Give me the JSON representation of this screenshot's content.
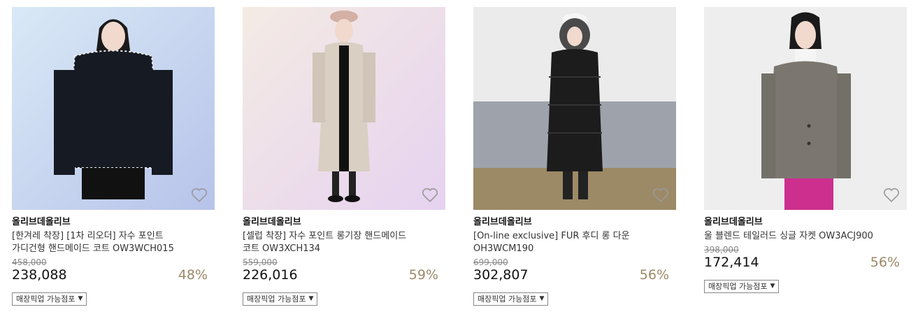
{
  "products": [
    {
      "brand": "올리브데올리브",
      "name": "[한겨레 착장] [1차 리오더] 자수 포인트 가디건형 핸드메이드 코트 OW3WCH015",
      "original_price": "458,000",
      "sale_price": "238,088",
      "discount": "48%",
      "pickup_label": "매장픽업 가능점포",
      "photo_bg": "#c6d4ec",
      "garment_color": "#161a22"
    },
    {
      "brand": "올리브데올리브",
      "name": "[셀럽 착장] 자수 포인트 롱기장 핸드메이드 코트 OW3XCH134",
      "original_price": "559,000",
      "sale_price": "226,016",
      "discount": "59%",
      "pickup_label": "매장픽업 가능점포",
      "photo_bg": "#efe0e8",
      "garment_color": "#d9cfc3"
    },
    {
      "brand": "올리브데올리브",
      "name": "[On-line exclusive] FUR 후디 롱 다운 OH3WCM190",
      "original_price": "699,000",
      "sale_price": "302,807",
      "discount": "56%",
      "pickup_label": "매장픽업 가능점포",
      "photo_bg": "#e6e6e6",
      "garment_color": "#1c1c1c"
    },
    {
      "brand": "올리브데올리브",
      "name": "울 블렌드 테일러드 싱글 자켓 OW3ACJ900",
      "original_price": "398,000",
      "sale_price": "172,414",
      "discount": "56%",
      "pickup_label": "매장픽업 가능점포",
      "photo_bg": "#eeeeee",
      "garment_color": "#7b7770"
    }
  ],
  "icons": {
    "wishlist": "heart-outline-icon",
    "dropdown": "caret-down-icon"
  },
  "colors": {
    "discount": "#9a8966",
    "text": "#111111"
  }
}
